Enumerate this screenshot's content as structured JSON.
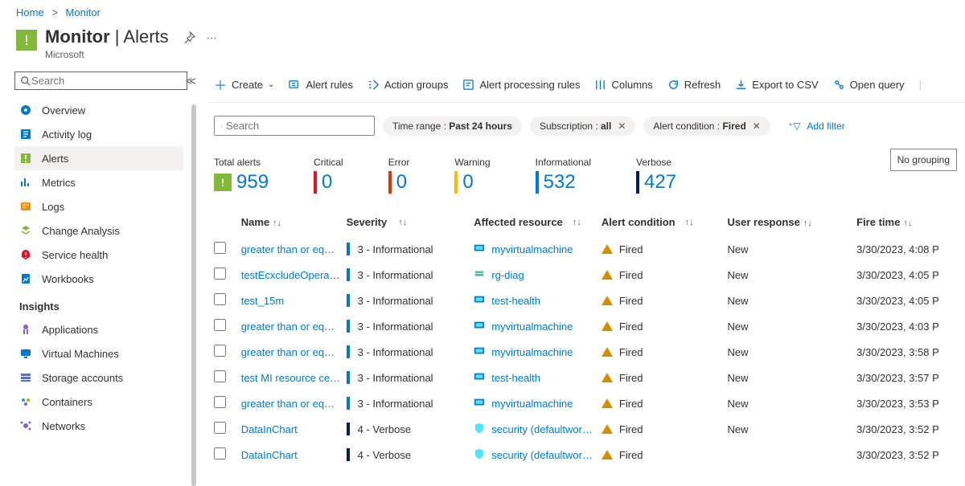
{
  "breadcrumb": {
    "home": "Home",
    "monitor": "Monitor"
  },
  "header": {
    "title": "Monitor",
    "subtitle": "Alerts",
    "provider": "Microsoft"
  },
  "sidebar": {
    "search_placeholder": "Search",
    "items": [
      {
        "label": "Overview",
        "icon": "overview"
      },
      {
        "label": "Activity log",
        "icon": "activity"
      },
      {
        "label": "Alerts",
        "icon": "alerts",
        "active": true
      },
      {
        "label": "Metrics",
        "icon": "metrics"
      },
      {
        "label": "Logs",
        "icon": "logs"
      },
      {
        "label": "Change Analysis",
        "icon": "change"
      },
      {
        "label": "Service health",
        "icon": "service"
      },
      {
        "label": "Workbooks",
        "icon": "workbooks"
      }
    ],
    "insights_label": "Insights",
    "insights": [
      {
        "label": "Applications",
        "icon": "apps"
      },
      {
        "label": "Virtual Machines",
        "icon": "vms"
      },
      {
        "label": "Storage accounts",
        "icon": "storage"
      },
      {
        "label": "Containers",
        "icon": "containers"
      },
      {
        "label": "Networks",
        "icon": "networks"
      }
    ]
  },
  "toolbar": {
    "create": "Create",
    "alert_rules": "Alert rules",
    "action_groups": "Action groups",
    "processing_rules": "Alert processing rules",
    "columns": "Columns",
    "refresh": "Refresh",
    "export_csv": "Export to CSV",
    "open_query": "Open query"
  },
  "filters": {
    "search_placeholder": "Search",
    "time_range_label": "Time range : ",
    "time_range_value": "Past 24 hours",
    "subscription_label": "Subscription : ",
    "subscription_value": "all",
    "condition_label": "Alert condition : ",
    "condition_value": "Fired",
    "add_filter": "Add filter"
  },
  "stats": {
    "total_label": "Total alerts",
    "total_value": "959",
    "critical_label": "Critical",
    "critical_value": "0",
    "critical_color": "#e81123",
    "error_label": "Error",
    "error_value": "0",
    "error_color": "#d83b01",
    "warning_label": "Warning",
    "warning_value": "0",
    "warning_color": "#ffb900",
    "info_label": "Informational",
    "info_value": "532",
    "info_color": "#0078d4",
    "verbose_label": "Verbose",
    "verbose_value": "427",
    "verbose_color": "#002050",
    "grouping": "No grouping"
  },
  "table": {
    "columns": {
      "name": "Name",
      "severity": "Severity",
      "resource": "Affected resource",
      "condition": "Alert condition",
      "user": "User response",
      "fire": "Fire time"
    },
    "rows": [
      {
        "name": "greater than or eq…",
        "severity": "3 - Informational",
        "sev_color": "#0078d4",
        "resource": "myvirtualmachine",
        "res_icon": "vm",
        "condition": "Fired",
        "user": "New",
        "fire": "3/30/2023, 4:08 P"
      },
      {
        "name": "testEcxcludeOperat…",
        "severity": "3 - Informational",
        "sev_color": "#0078d4",
        "resource": "rg-diag",
        "res_icon": "rg",
        "condition": "Fired",
        "user": "New",
        "fire": "3/30/2023, 4:05 P"
      },
      {
        "name": "test_15m",
        "severity": "3 - Informational",
        "sev_color": "#0078d4",
        "resource": "test-health",
        "res_icon": "vm",
        "condition": "Fired",
        "user": "New",
        "fire": "3/30/2023, 4:05 P"
      },
      {
        "name": "greater than or eq…",
        "severity": "3 - Informational",
        "sev_color": "#0078d4",
        "resource": "myvirtualmachine",
        "res_icon": "vm",
        "condition": "Fired",
        "user": "New",
        "fire": "3/30/2023, 4:03 P"
      },
      {
        "name": "greater than or eq…",
        "severity": "3 - Informational",
        "sev_color": "#0078d4",
        "resource": "myvirtualmachine",
        "res_icon": "vm",
        "condition": "Fired",
        "user": "New",
        "fire": "3/30/2023, 3:58 P"
      },
      {
        "name": "test MI resource ce…",
        "severity": "3 - Informational",
        "sev_color": "#0078d4",
        "resource": "test-health",
        "res_icon": "vm",
        "condition": "Fired",
        "user": "New",
        "fire": "3/30/2023, 3:57 P"
      },
      {
        "name": "greater than or eq…",
        "severity": "3 - Informational",
        "sev_color": "#0078d4",
        "resource": "myvirtualmachine",
        "res_icon": "vm",
        "condition": "Fired",
        "user": "New",
        "fire": "3/30/2023, 3:53 P"
      },
      {
        "name": "DataInChart",
        "severity": "4 - Verbose",
        "sev_color": "#002050",
        "resource": "security (defaultwor…",
        "res_icon": "sec",
        "condition": "Fired",
        "user": "New",
        "fire": "3/30/2023, 3:52 P"
      },
      {
        "name": "DataInChart",
        "severity": "4 - Verbose",
        "sev_color": "#002050",
        "resource": "security (defaultwor…",
        "res_icon": "sec",
        "condition": "Fired",
        "user": "",
        "fire": "3/30/2023, 3:52 P"
      }
    ]
  }
}
